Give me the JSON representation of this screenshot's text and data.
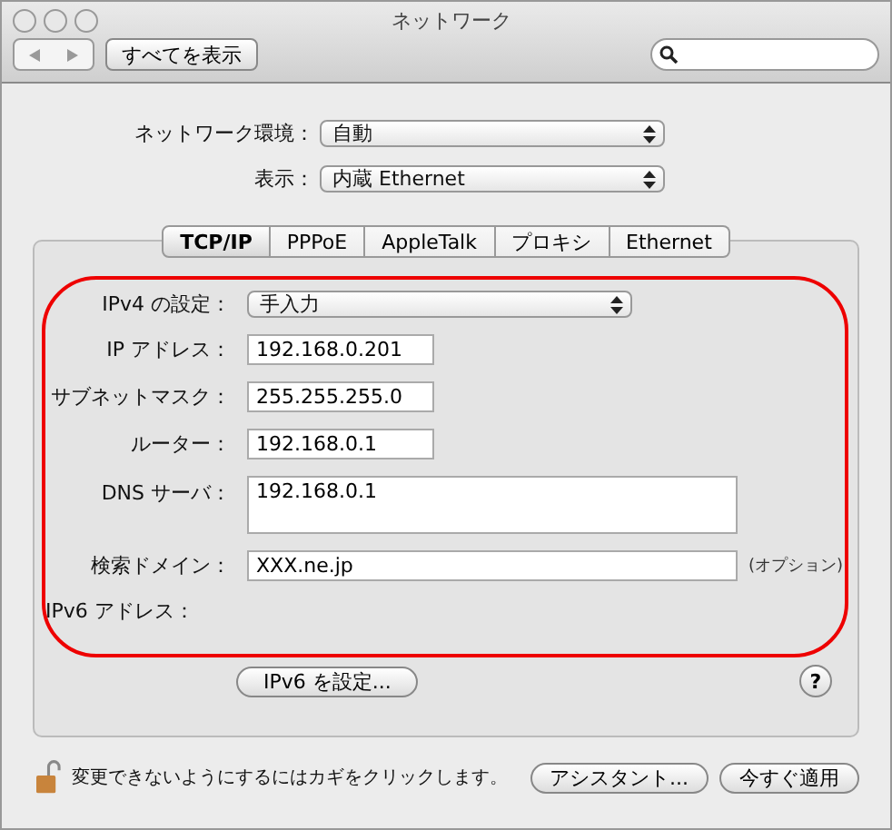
{
  "window": {
    "title": "ネットワーク"
  },
  "toolbar": {
    "show_all": "すべてを表示"
  },
  "location": {
    "label": "ネットワーク環境：",
    "value": "自動"
  },
  "show": {
    "label": "表示：",
    "value": "内蔵 Ethernet"
  },
  "tabs": [
    {
      "label": "TCP/IP",
      "selected": true
    },
    {
      "label": "PPPoE",
      "selected": false
    },
    {
      "label": "AppleTalk",
      "selected": false
    },
    {
      "label": "プロキシ",
      "selected": false
    },
    {
      "label": "Ethernet",
      "selected": false
    }
  ],
  "ipv4": {
    "label": "IPv4 の設定：",
    "value": "手入力"
  },
  "fields": [
    {
      "label": "IP アドレス：",
      "value": "192.168.0.201",
      "kind": "short"
    },
    {
      "label": "サブネットマスク：",
      "value": "255.255.255.0",
      "kind": "short"
    },
    {
      "label": "ルーター：",
      "value": "192.168.0.1",
      "kind": "short"
    },
    {
      "label": "DNS サーバ：",
      "value": "192.168.0.1",
      "kind": "area"
    },
    {
      "label": "検索ドメイン：",
      "value": "XXX.ne.jp",
      "kind": "wide",
      "note": "(オプション)"
    }
  ],
  "ipv6_label": "IPv6 アドレス：",
  "ipv6_button": "IPv6 を設定...",
  "help": "?",
  "footer": {
    "lock_text": "変更できないようにするにはカギをクリックします。",
    "buttons": [
      "アシスタント...",
      "今すぐ適用"
    ]
  }
}
